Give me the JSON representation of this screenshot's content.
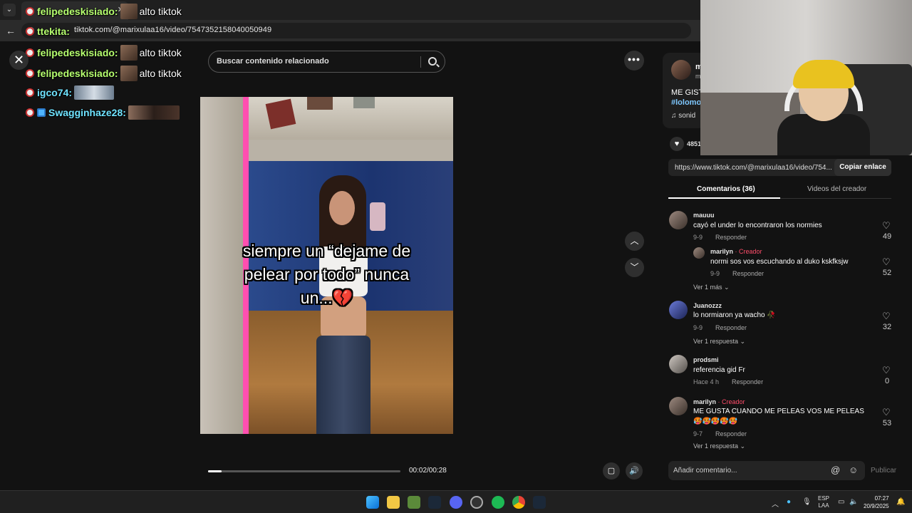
{
  "browser": {
    "url": "tiktok.com/@marixulaa16/video/7547352158040050949",
    "back_icon": "←"
  },
  "chat": [
    {
      "user": "felipedeskisiado:",
      "text": "alto tiktok"
    },
    {
      "user": "ttekita:",
      "text": ""
    },
    {
      "user": "felipedeskisiado:",
      "text": "alto tiktok"
    },
    {
      "user": "felipedeskisiado:",
      "text": "alto tiktok"
    },
    {
      "user": "igco74:",
      "text": ""
    },
    {
      "user": "Swagginhaze28:",
      "text": ""
    }
  ],
  "close_icon": "✕",
  "search": {
    "placeholder": "Buscar contenido relacionado"
  },
  "more_icon": "•••",
  "video": {
    "caption_line1": "siempre un “dejame de",
    "caption_line2": "pelear por todo” nunca",
    "caption_line3": "un...💔",
    "progress": 0.071,
    "time": "00:02/00:28"
  },
  "nav": {
    "up": "︿",
    "down": "﹀"
  },
  "creator": {
    "name": "m",
    "handle": "m",
    "description": "ME GIST",
    "hashtag": "#lolomo",
    "sound": "♫ sonid",
    "likes": "4851"
  },
  "link": {
    "url": "https://www.tiktok.com/@marixulaa16/video/754...",
    "copy_label": "Copiar enlace"
  },
  "tabs": {
    "comments": "Comentarios (36)",
    "creator_videos": "Videos del creador"
  },
  "comments": [
    {
      "user": "mauuu",
      "text": "cayó el under lo encontraron los normies",
      "date": "9-9",
      "reply": "Responder",
      "likes": "49"
    },
    {
      "user": "marilyn",
      "creator": "· Creador",
      "text": "normi sos vos escuchando al duko kskfksjw",
      "date": "9-9",
      "reply": "Responder",
      "likes": "52"
    },
    {
      "user": "Juanozzz",
      "text": "lo normiaron ya wacho 🥀",
      "date": "9-9",
      "reply": "Responder",
      "likes": "32"
    },
    {
      "user": "prodsmi",
      "text": "referencia gid Fr",
      "date": "Hace 4 h",
      "reply": "Responder",
      "likes": "0"
    },
    {
      "user": "marilyn",
      "creator": "· Creador",
      "text": "ME GUSTA CUANDO ME PELEAS VOS ME PELEAS",
      "text2": "🥵🥵🥵🥵🥵",
      "date": "9-7",
      "reply": "Responder",
      "likes": "53"
    }
  ],
  "more_replies": {
    "m1": "Ver 1 más ⌄",
    "m2": "Ver 1 respuesta ⌄",
    "m3": "Ver 1 respuesta ⌄"
  },
  "compose": {
    "placeholder": "Añadir comentario...",
    "at": "@",
    "emoji": "☺",
    "post": "Publicar"
  },
  "taskbar": {
    "lang1": "ESP",
    "lang2": "LAA",
    "time": "07:27",
    "date": "20/9/2025"
  }
}
